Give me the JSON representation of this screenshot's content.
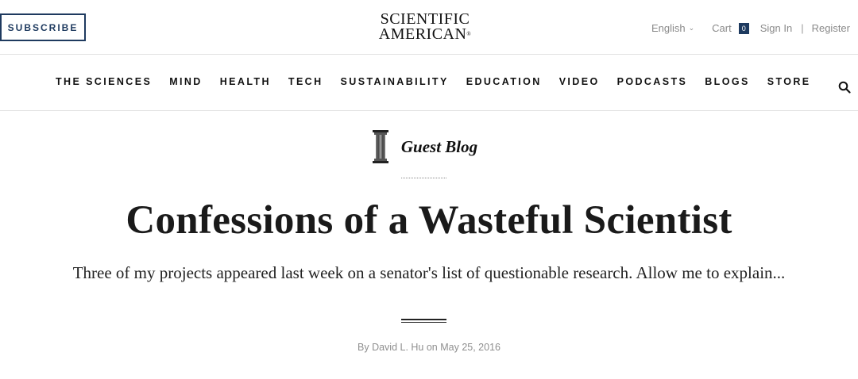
{
  "header": {
    "subscribe_label": "SUBSCRIBE",
    "logo_line1": "SCIENTIFIC",
    "logo_line2": "AMERICAN",
    "logo_mark": "®",
    "language": "English",
    "cart_label": "Cart",
    "cart_count": "0",
    "sign_in_label": "Sign In",
    "separator": "|",
    "register_label": "Register"
  },
  "nav": {
    "items": [
      {
        "label": "THE SCIENCES"
      },
      {
        "label": "MIND"
      },
      {
        "label": "HEALTH"
      },
      {
        "label": "TECH"
      },
      {
        "label": "SUSTAINABILITY"
      },
      {
        "label": "EDUCATION"
      },
      {
        "label": "VIDEO"
      },
      {
        "label": "PODCASTS"
      },
      {
        "label": "BLOGS"
      },
      {
        "label": "STORE"
      }
    ],
    "search_icon": "search-icon"
  },
  "article": {
    "blog_name": "Guest Blog",
    "blog_icon": "column-icon",
    "headline": "Confessions of a Wasteful Scientist",
    "dek": "Three of my projects appeared last week on a senator's list of questionable research. Allow me to explain...",
    "byline": "By David L. Hu on May 25, 2016"
  },
  "colors": {
    "brand_navy": "#1e3a5f",
    "muted_text": "#8a8a8a",
    "divider": "#e2e2e2"
  }
}
